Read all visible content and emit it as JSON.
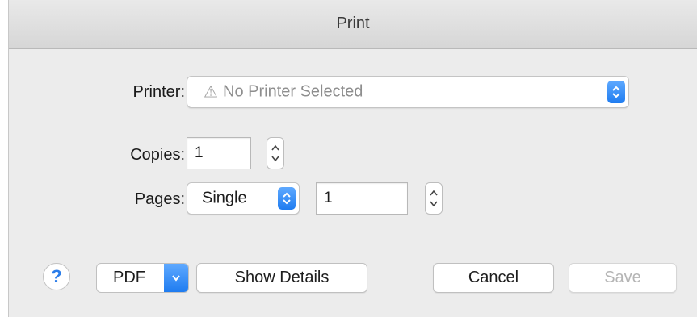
{
  "window": {
    "title": "Print"
  },
  "printer": {
    "label": "Printer:",
    "warning_icon": "⚠",
    "value": "No Printer Selected"
  },
  "copies": {
    "label": "Copies:",
    "value": "1"
  },
  "pages": {
    "label": "Pages:",
    "mode": "Single",
    "value": "1"
  },
  "footer": {
    "help_label": "?",
    "pdf_label": "PDF",
    "show_details_label": "Show Details",
    "cancel_label": "Cancel",
    "save_label": "Save"
  },
  "colors": {
    "accent": "#2f86f5",
    "disabled_text": "#b5b5b5",
    "background": "#ececec"
  }
}
